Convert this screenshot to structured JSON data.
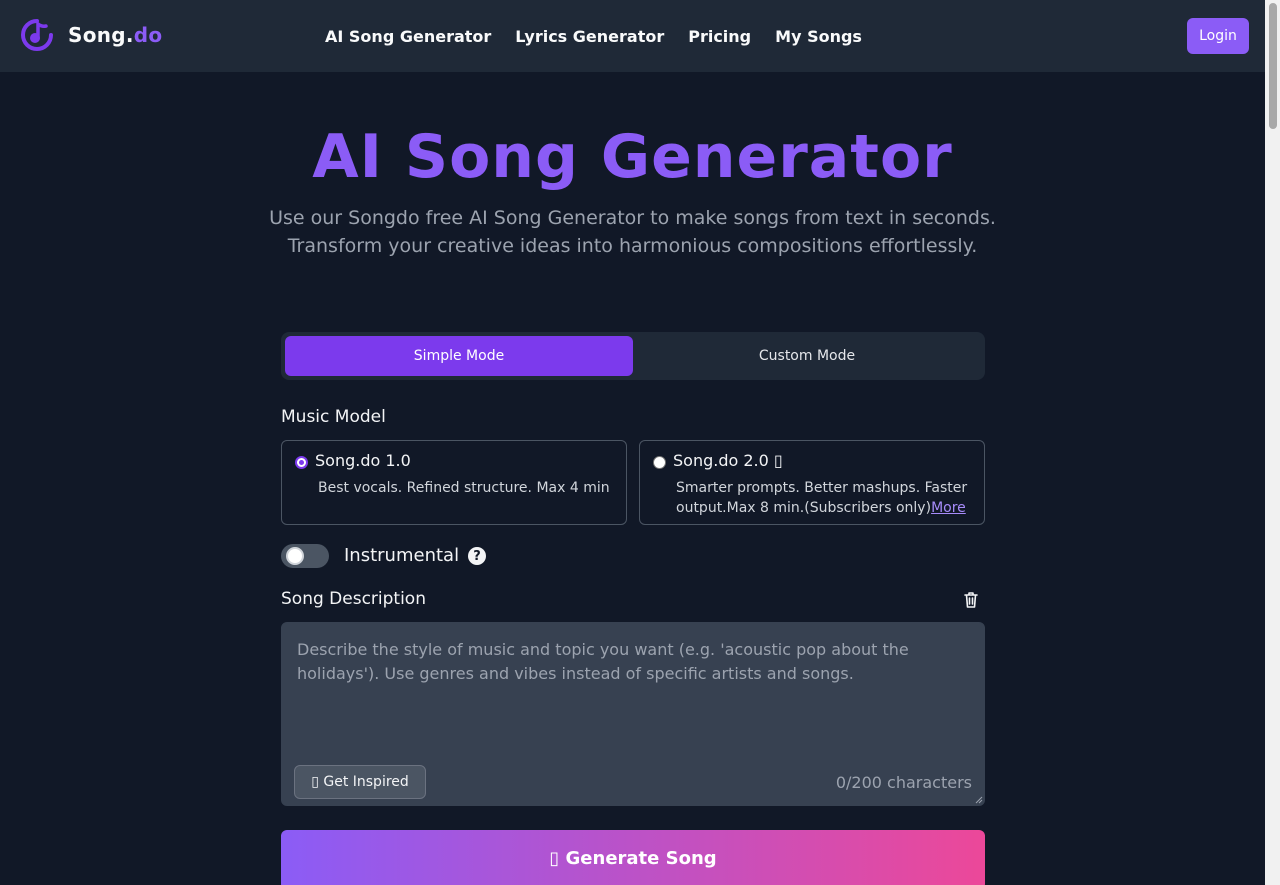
{
  "header": {
    "logo_main": "Song.",
    "logo_accent": "do",
    "nav": [
      {
        "label": "AI Song Generator"
      },
      {
        "label": "Lyrics Generator"
      },
      {
        "label": "Pricing"
      },
      {
        "label": "My Songs"
      }
    ],
    "login_label": "Login"
  },
  "hero": {
    "title": "AI Song Generator",
    "subtitle_line1": "Use our Songdo free AI Song Generator to make songs from text in seconds.",
    "subtitle_line2": "Transform your creative ideas into harmonious compositions effortlessly."
  },
  "modes": {
    "simple": "Simple Mode",
    "custom": "Custom Mode",
    "active": "simple"
  },
  "music_model": {
    "label": "Music Model",
    "options": [
      {
        "name": "Song.do 1.0",
        "desc": "Best vocals. Refined structure. Max 4 min",
        "selected": true
      },
      {
        "name": "Song.do 2.0 ▯",
        "desc": "Smarter prompts. Better mashups. Faster output.Max 8 min.(Subscribers only)",
        "more": "More",
        "selected": false
      }
    ]
  },
  "instrumental": {
    "label": "Instrumental",
    "enabled": false,
    "help_glyph": "?"
  },
  "song_description": {
    "label": "Song Description",
    "value": "",
    "placeholder": "Describe the style of music and topic you want (e.g. 'acoustic pop about the holidays'). Use genres and vibes instead of specific artists and songs.",
    "inspire_label": "▯ Get Inspired",
    "char_count": "0/200 characters"
  },
  "generate_label": "▯ Generate Song",
  "colors": {
    "accent": "#8b5cf6",
    "background": "#111827",
    "header": "#1f2937",
    "gradient_end": "#ec4899"
  },
  "icons": [
    "music-note-logo-icon",
    "help-icon",
    "trash-icon"
  ]
}
